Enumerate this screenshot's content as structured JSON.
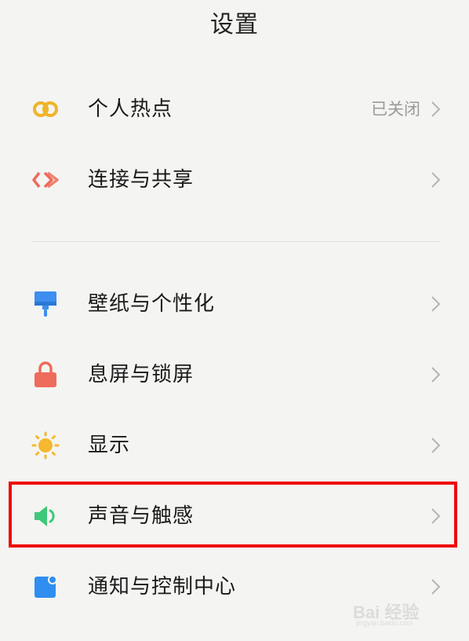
{
  "header": {
    "title": "设置"
  },
  "items": [
    {
      "label": "个人热点",
      "value": "已关闭",
      "icon": "hotspot-icon",
      "color": "#f0b429"
    },
    {
      "label": "连接与共享",
      "value": "",
      "icon": "connection-share-icon",
      "color": "#ef6b5b"
    },
    {
      "label": "壁纸与个性化",
      "value": "",
      "icon": "wallpaper-brush-icon",
      "color": "#3d8ef0"
    },
    {
      "label": "息屏与锁屏",
      "value": "",
      "icon": "lock-icon",
      "color": "#ef6b5b"
    },
    {
      "label": "显示",
      "value": "",
      "icon": "sun-icon",
      "color": "#f5b82e"
    },
    {
      "label": "声音与触感",
      "value": "",
      "icon": "speaker-icon",
      "color": "#3dc87a"
    },
    {
      "label": "通知与控制中心",
      "value": "",
      "icon": "notification-icon",
      "color": "#2f8ef0"
    }
  ],
  "highlight_color": "#ee0a0a",
  "watermark": {
    "brand": "Bai 经验",
    "sub": "jingyan.baidu.com"
  }
}
